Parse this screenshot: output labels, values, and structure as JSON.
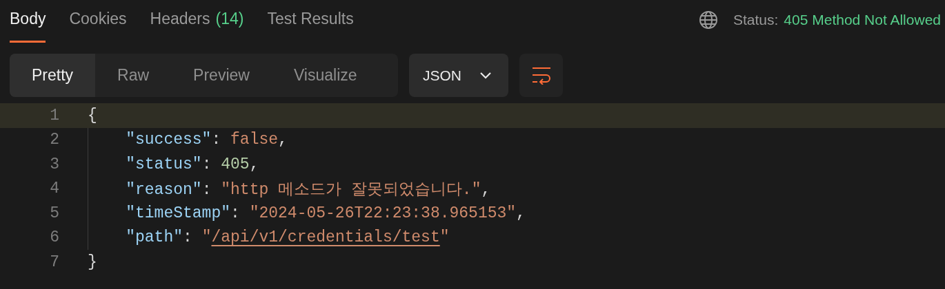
{
  "tabs": [
    {
      "label": "Body",
      "selected": true
    },
    {
      "label": "Cookies",
      "selected": false
    },
    {
      "label": "Headers",
      "count": "(14)",
      "selected": false
    },
    {
      "label": "Test Results",
      "selected": false
    }
  ],
  "status": {
    "label": "Status:",
    "value": "405 Method Not Allowed"
  },
  "view_modes": [
    {
      "label": "Pretty",
      "selected": true
    },
    {
      "label": "Raw",
      "selected": false
    },
    {
      "label": "Preview",
      "selected": false
    },
    {
      "label": "Visualize",
      "selected": false
    }
  ],
  "format_dropdown": {
    "value": "JSON"
  },
  "code": {
    "lines": [
      {
        "number": "1",
        "current": true,
        "tokens": [
          {
            "kind": "punct",
            "text": "{"
          }
        ],
        "children": [
          {
            "number": "2",
            "current": false,
            "tokens": [
              {
                "kind": "key",
                "text": "\"success\""
              },
              {
                "kind": "punct",
                "text": ": "
              },
              {
                "kind": "literal",
                "text": "false"
              },
              {
                "kind": "punct",
                "text": ","
              }
            ]
          },
          {
            "number": "3",
            "current": false,
            "tokens": [
              {
                "kind": "key",
                "text": "\"status\""
              },
              {
                "kind": "punct",
                "text": ": "
              },
              {
                "kind": "number",
                "text": "405"
              },
              {
                "kind": "punct",
                "text": ","
              }
            ]
          },
          {
            "number": "4",
            "current": false,
            "tokens": [
              {
                "kind": "key",
                "text": "\"reason\""
              },
              {
                "kind": "punct",
                "text": ": "
              },
              {
                "kind": "string",
                "text": "\"http 메소드가 잘못되었습니다.\""
              },
              {
                "kind": "punct",
                "text": ","
              }
            ]
          },
          {
            "number": "5",
            "current": false,
            "tokens": [
              {
                "kind": "key",
                "text": "\"timeStamp\""
              },
              {
                "kind": "punct",
                "text": ": "
              },
              {
                "kind": "string",
                "text": "\"2024-05-26T22:23:38.965153\""
              },
              {
                "kind": "punct",
                "text": ","
              }
            ]
          },
          {
            "number": "6",
            "current": false,
            "tokens": [
              {
                "kind": "key",
                "text": "\"path\""
              },
              {
                "kind": "punct",
                "text": ": "
              },
              {
                "kind": "string",
                "text": "\""
              },
              {
                "kind": "link",
                "text": "/api/v1/credentials/test"
              },
              {
                "kind": "string",
                "text": "\""
              }
            ]
          }
        ]
      },
      {
        "number": "7",
        "current": false,
        "tokens": [
          {
            "kind": "punct",
            "text": "}"
          }
        ]
      }
    ]
  }
}
